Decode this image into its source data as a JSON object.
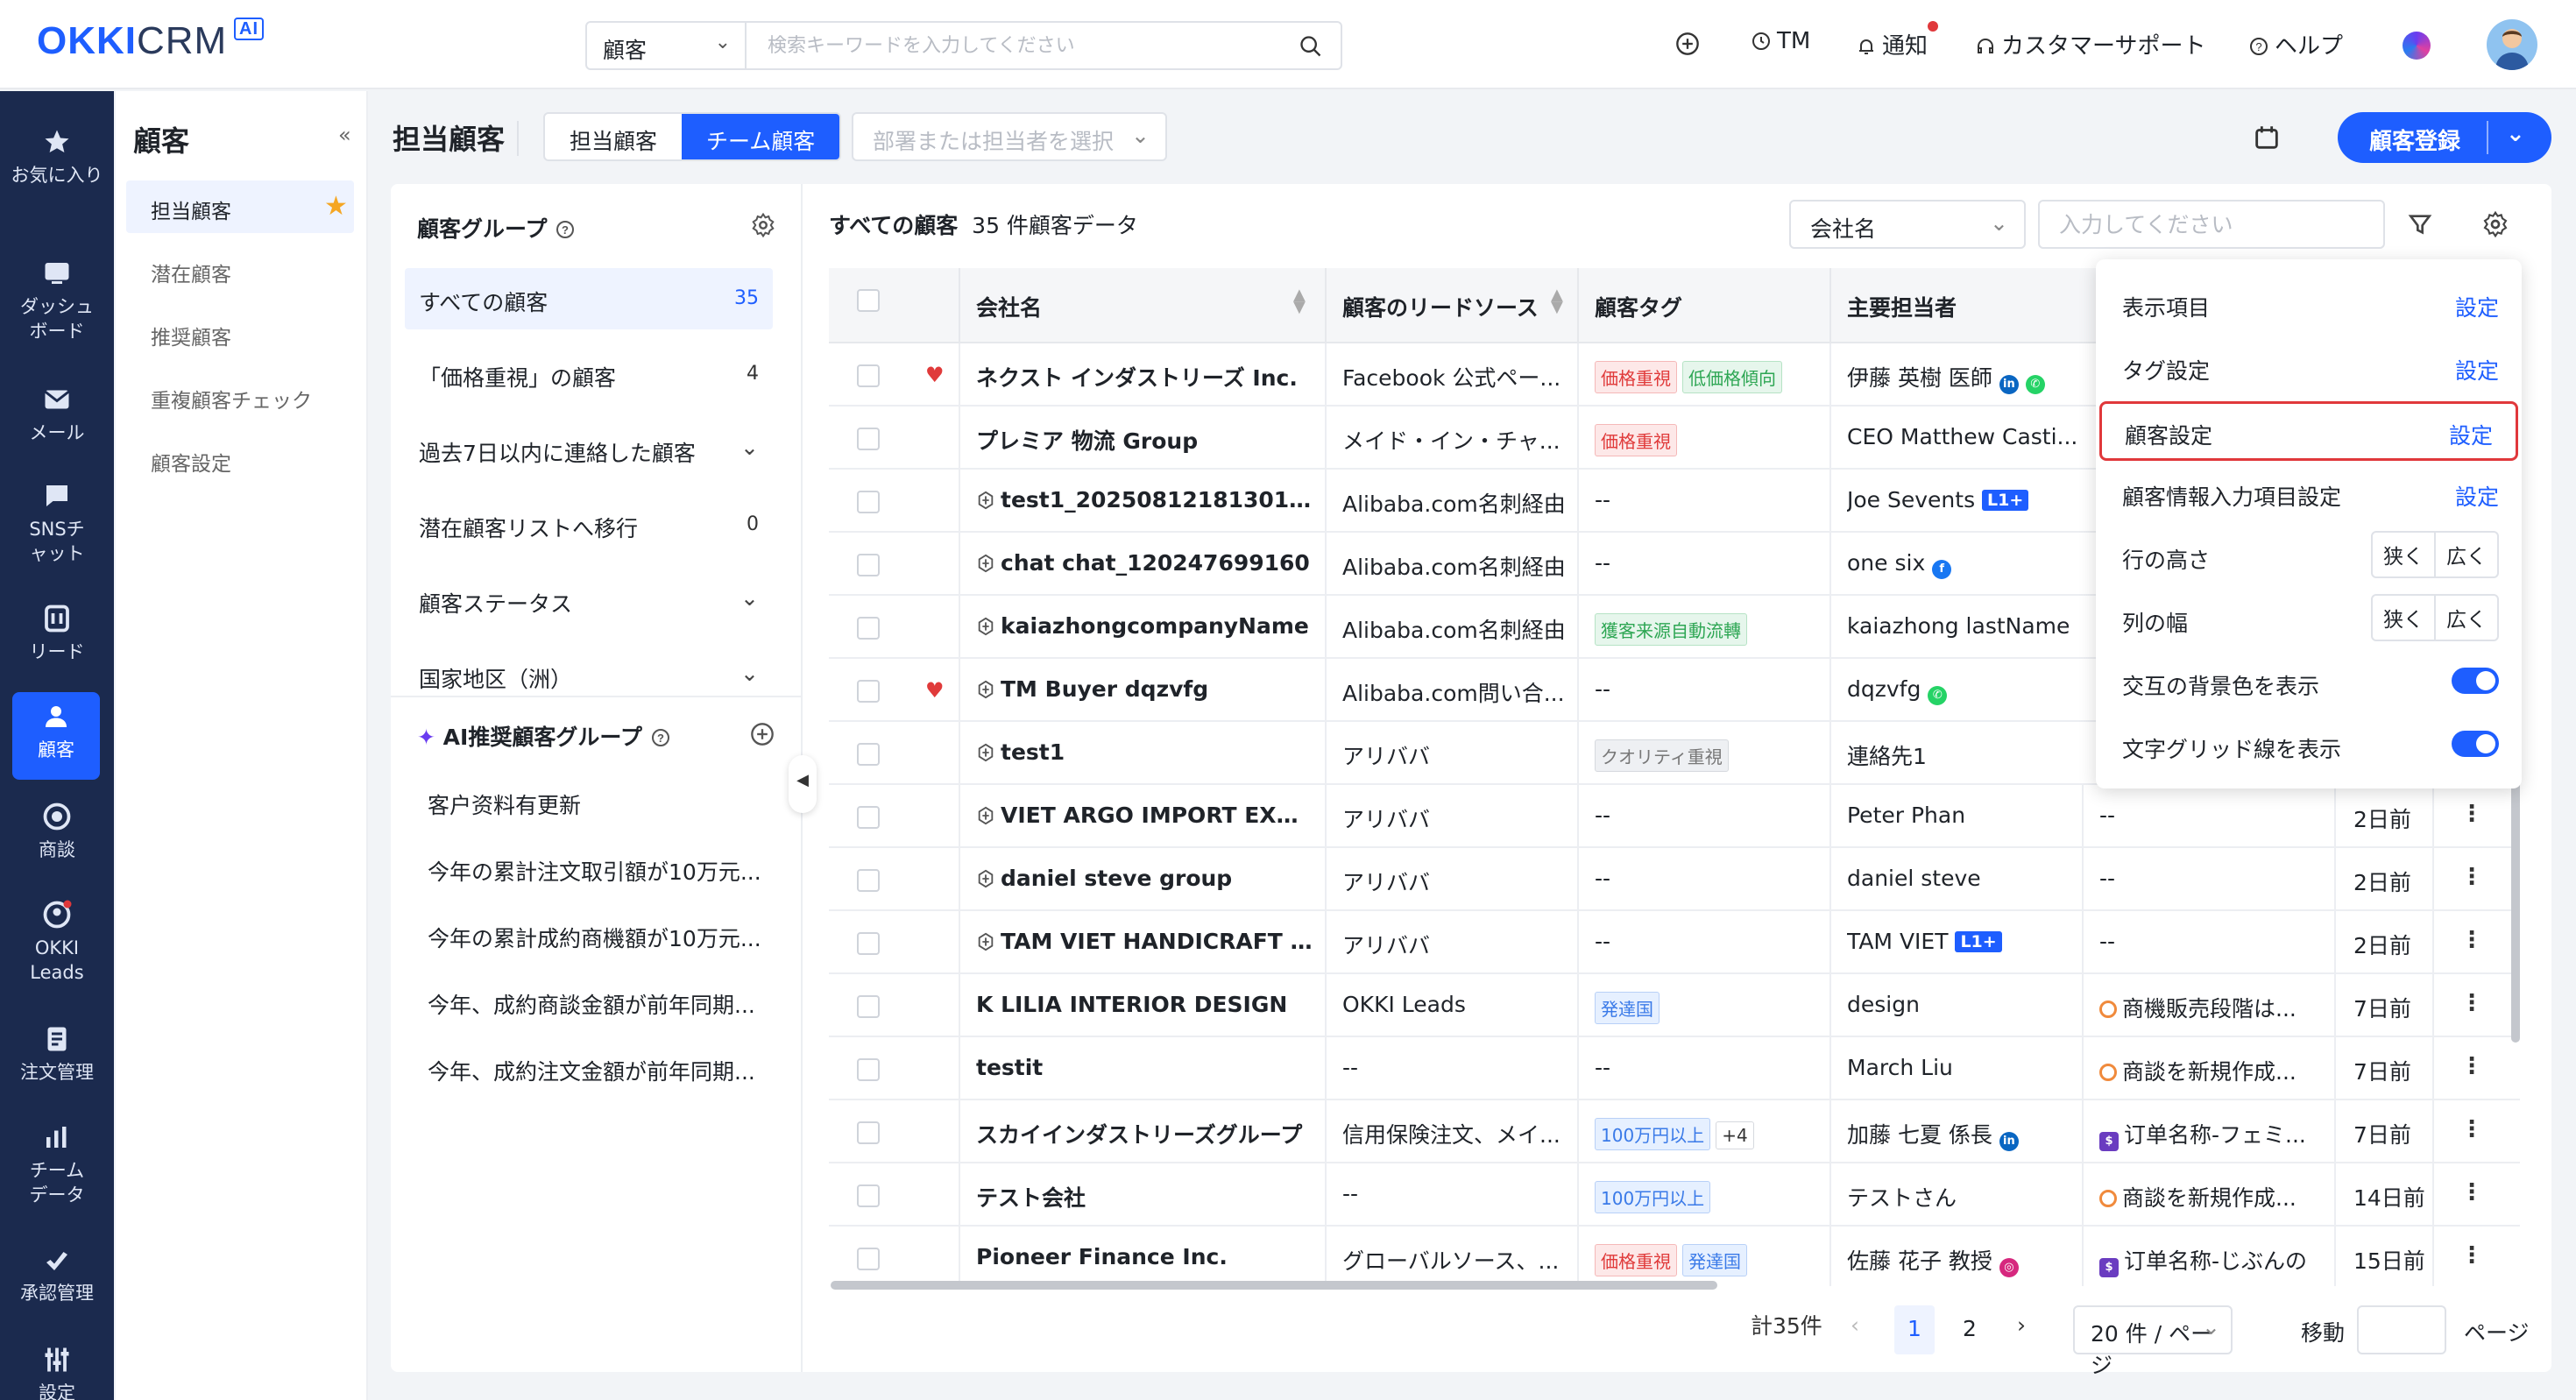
{
  "app": {
    "logo_main": "OKKI",
    "logo_sub": "CRM",
    "logo_badge": "AI"
  },
  "search": {
    "type": "顧客",
    "placeholder": "検索キーワードを入力してください"
  },
  "topbar": {
    "tm": "TM",
    "notify": "通知",
    "support": "カスタマーサポート",
    "help": "ヘルプ"
  },
  "rail": [
    {
      "label": "お気に入り",
      "icon": "star-icon"
    },
    {
      "label": "ダッシュボード",
      "icon": "dashboard-icon"
    },
    {
      "label": "メール",
      "icon": "mail-icon"
    },
    {
      "label": "SNSチャット",
      "icon": "chat-icon"
    },
    {
      "label": "リード",
      "icon": "lead-icon"
    },
    {
      "label": "顧客",
      "icon": "customer-icon"
    },
    {
      "label": "商談",
      "icon": "deal-icon"
    },
    {
      "label": "OKKI Leads",
      "icon": "okki-leads-icon"
    },
    {
      "label": "注文管理",
      "icon": "order-icon"
    },
    {
      "label": "チームデータ",
      "icon": "team-data-icon"
    },
    {
      "label": "承認管理",
      "icon": "approval-icon"
    },
    {
      "label": "設定",
      "icon": "settings-icon"
    }
  ],
  "subnav": {
    "title": "顧客",
    "items": [
      "担当顧客",
      "潜在顧客",
      "推奨顧客",
      "重複顧客チェック",
      "顧客設定"
    ]
  },
  "header": {
    "title": "担当顧客",
    "tabs": [
      "担当顧客",
      "チーム顧客"
    ],
    "dept_placeholder": "部署または担当者を選択",
    "register": "顧客登録"
  },
  "groups": {
    "title": "顧客グループ",
    "items": [
      {
        "label": "すべての顧客",
        "count": "35"
      },
      {
        "label": "「価格重視」の顧客",
        "count": "4"
      },
      {
        "label": "過去7日以内に連絡した顧客",
        "count": ""
      },
      {
        "label": "潜在顧客リストへ移行",
        "count": "0"
      },
      {
        "label": "顧客ステータス",
        "count": ""
      },
      {
        "label": "国家地区（洲）",
        "count": ""
      }
    ],
    "ai_title": "AI推奨顧客グループ",
    "ai_items": [
      "客户资料有更新",
      "今年の累計注文取引額が10万元...",
      "今年の累計成約商機額が10万元...",
      "今年、成約商談金額が前年同期...",
      "今年、成約注文金額が前年同期..."
    ]
  },
  "list": {
    "title": "すべての顧客",
    "count_text": "35 件顧客データ",
    "field_select": "会社名",
    "filter_placeholder": "入力してください"
  },
  "table": {
    "columns": [
      "会社名",
      "顧客のリードソース",
      "顧客タグ",
      "主要担当者"
    ],
    "rows": [
      {
        "fav": true,
        "company": "ネクスト インダストリーズ Inc.",
        "alibaba": false,
        "source": "Facebook 公式ペー...",
        "tags": [
          [
            "価格重視",
            "red"
          ],
          [
            "低価格傾向",
            "green"
          ]
        ],
        "contact": "伊藤 英樹 医師",
        "badge": "in+wa",
        "extra": "",
        "time": ""
      },
      {
        "fav": false,
        "company": "プレミア 物流 Group",
        "alibaba": false,
        "source": "メイド・イン・チャ...",
        "tags": [
          [
            "価格重視",
            "red"
          ]
        ],
        "contact": "CEO Matthew Casti...",
        "badge": "",
        "extra": "",
        "time": ""
      },
      {
        "fav": false,
        "company": "test1_20250812181301...",
        "alibaba": true,
        "source": "Alibaba.com名刺経由",
        "tags": [],
        "contact": "Joe Sevents",
        "badge": "L1+",
        "extra": "",
        "time": ""
      },
      {
        "fav": false,
        "company": "chat chat_120247699160",
        "alibaba": true,
        "source": "Alibaba.com名刺経由",
        "tags": [],
        "contact": "one six",
        "badge": "fb",
        "extra": "",
        "time": ""
      },
      {
        "fav": false,
        "company": "kaiazhongcompanyName",
        "alibaba": true,
        "source": "Alibaba.com名刺経由",
        "tags": [
          [
            "獲客来源自動流轉",
            "green"
          ]
        ],
        "contact": "kaiazhong lastName",
        "badge": "",
        "extra": "",
        "time": ""
      },
      {
        "fav": true,
        "company": "TM Buyer dqzvfg",
        "alibaba": true,
        "source": "Alibaba.com問い合...",
        "tags": [],
        "contact": "dqzvfg",
        "badge": "wa",
        "extra": "",
        "time": ""
      },
      {
        "fav": false,
        "company": "test1",
        "alibaba": true,
        "source": "アリババ",
        "tags": [
          [
            "クオリティ重視",
            "grey"
          ]
        ],
        "contact": "連絡先1",
        "badge": "",
        "extra": "",
        "time": ""
      },
      {
        "fav": false,
        "company": "VIET ARGO IMPORT EXPO...",
        "alibaba": true,
        "source": "アリババ",
        "tags": [],
        "contact": "Peter Phan",
        "badge": "",
        "extra": "--",
        "time": "2日前"
      },
      {
        "fav": false,
        "company": "daniel steve group",
        "alibaba": true,
        "source": "アリババ",
        "tags": [],
        "contact": "daniel steve",
        "badge": "",
        "extra": "--",
        "time": "2日前"
      },
      {
        "fav": false,
        "company": "TAM VIET HANDICRAFT E...",
        "alibaba": true,
        "source": "アリババ",
        "tags": [],
        "contact": "TAM VIET",
        "badge": "L1+",
        "extra": "--",
        "time": "2日前"
      },
      {
        "fav": false,
        "company": "K LILIA INTERIOR DESIGN",
        "alibaba": false,
        "source": "OKKI Leads",
        "tags": [
          [
            "発達国",
            "blue"
          ]
        ],
        "contact": "design",
        "badge": "",
        "extra": "商機販売段階は...",
        "extra_icon": "deal",
        "time": "7日前"
      },
      {
        "fav": false,
        "company": "testit",
        "alibaba": false,
        "source": "--",
        "tags": [],
        "contact": "March Liu",
        "badge": "",
        "extra": "商談を新規作成...",
        "extra_icon": "deal",
        "time": "7日前"
      },
      {
        "fav": false,
        "company": "スカイインダストリーズグループ",
        "alibaba": false,
        "source": "信用保険注文、メイ...",
        "tags": [
          [
            "100万円以上",
            "blue"
          ],
          [
            "+4",
            "more"
          ]
        ],
        "contact": "加藤 七夏 係長",
        "badge": "in",
        "extra": "订单名称-フェミ...",
        "extra_icon": "order",
        "time": "7日前"
      },
      {
        "fav": false,
        "company": "テスト会社",
        "alibaba": false,
        "source": "--",
        "tags": [
          [
            "100万円以上",
            "blue"
          ]
        ],
        "contact": "テストさん",
        "badge": "",
        "extra": "商談を新規作成...",
        "extra_icon": "deal",
        "time": "14日前"
      },
      {
        "fav": false,
        "company": "Pioneer Finance Inc.",
        "alibaba": false,
        "source": "グローバルソース、...",
        "tags": [
          [
            "価格重視",
            "red"
          ],
          [
            "発達国",
            "blue"
          ]
        ],
        "contact": "佐藤 花子 教授",
        "badge": "ig",
        "extra": "订单名称-じぶんの",
        "extra_icon": "order",
        "time": "15日前"
      }
    ],
    "empty": "--"
  },
  "popup": {
    "rows": [
      {
        "label": "表示項目",
        "action": "設定"
      },
      {
        "label": "タグ設定",
        "action": "設定"
      },
      {
        "label": "顧客設定",
        "action": "設定"
      },
      {
        "label": "顧客情報入力項目設定",
        "action": "設定"
      }
    ],
    "row_height": {
      "label": "行の高さ",
      "options": [
        "狭く",
        "広く"
      ]
    },
    "col_width": {
      "label": "列の幅",
      "options": [
        "狭く",
        "広く"
      ]
    },
    "alt_bg": {
      "label": "交互の背景色を表示",
      "on": true
    },
    "grid": {
      "label": "文字グリッド線を表示",
      "on": true
    }
  },
  "pager": {
    "total": "計35件",
    "pages": [
      "1",
      "2"
    ],
    "page_size": "20 件 / ページ",
    "goto": "移動",
    "goto_suffix": "ページ"
  },
  "colors": {
    "primary": "#1e5eff",
    "rail_bg": "#1b2a4e",
    "highlight": "#e0383b",
    "fav": "#e03a3a"
  }
}
